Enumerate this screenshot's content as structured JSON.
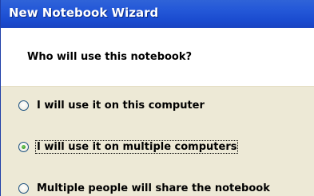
{
  "window": {
    "title": "New Notebook Wizard"
  },
  "header": {
    "question": "Who will use this notebook?"
  },
  "options": [
    {
      "label": "I will use it on this computer",
      "checked": false,
      "focused": false
    },
    {
      "label": "I will use it on multiple computers",
      "checked": true,
      "focused": true
    },
    {
      "label": "Multiple people will share the notebook",
      "checked": false,
      "focused": false
    }
  ],
  "colors": {
    "titlebar": "#2458d8",
    "body_background": "#ede9d6",
    "radio_dot": "#3a9a24"
  }
}
